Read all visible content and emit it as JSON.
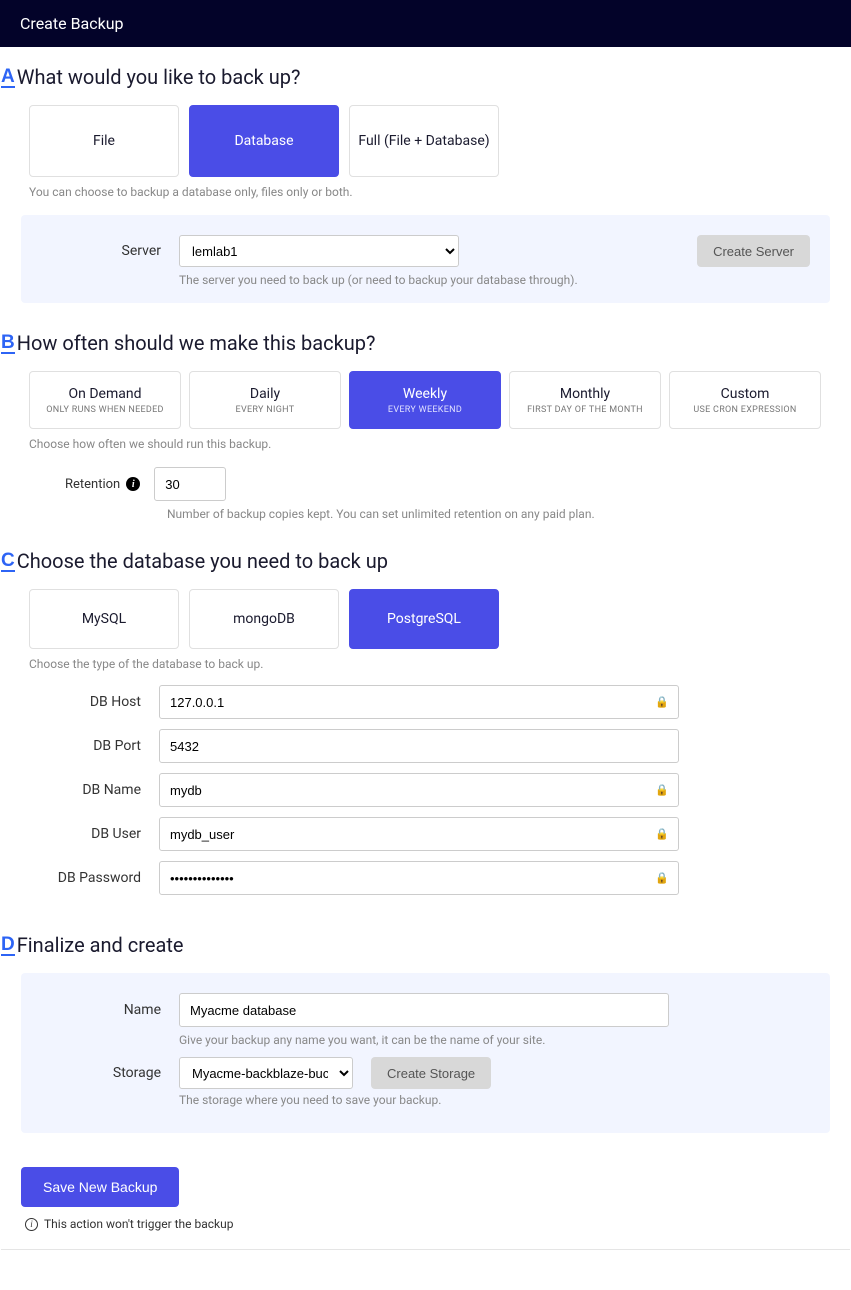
{
  "header": {
    "title": "Create Backup"
  },
  "sectionA": {
    "letter": "A",
    "title": "What would you like to back up?",
    "options": [
      {
        "label": "File"
      },
      {
        "label": "Database"
      },
      {
        "label": "Full (File + Database)"
      }
    ],
    "selected_index": 1,
    "hint": "You can choose to backup a database only, files only or both.",
    "server_label": "Server",
    "server_options": [
      "lemlab1"
    ],
    "server_selected": "lemlab1",
    "create_server_btn": "Create Server",
    "server_hint": "The server you need to back up (or need to backup your database through)."
  },
  "sectionB": {
    "letter": "B",
    "title": "How often should we make this backup?",
    "options": [
      {
        "label": "On Demand",
        "sub": "ONLY RUNS WHEN NEEDED"
      },
      {
        "label": "Daily",
        "sub": "EVERY NIGHT"
      },
      {
        "label": "Weekly",
        "sub": "EVERY WEEKEND"
      },
      {
        "label": "Monthly",
        "sub": "FIRST DAY OF THE MONTH"
      },
      {
        "label": "Custom",
        "sub": "USE CRON EXPRESSION"
      }
    ],
    "selected_index": 2,
    "hint": "Choose how often we should run this backup.",
    "retention_label": "Retention",
    "retention_value": "30",
    "retention_hint": "Number of backup copies kept. You can set unlimited retention on any paid plan."
  },
  "sectionC": {
    "letter": "C",
    "title": "Choose the database you need to back up",
    "options": [
      {
        "label": "MySQL"
      },
      {
        "label": "mongoDB"
      },
      {
        "label": "PostgreSQL"
      }
    ],
    "selected_index": 2,
    "hint": "Choose the type of the database to back up.",
    "fields": {
      "host_label": "DB Host",
      "host_value": "127.0.0.1",
      "port_label": "DB Port",
      "port_value": "5432",
      "name_label": "DB Name",
      "name_value": "mydb",
      "user_label": "DB User",
      "user_value": "mydb_user",
      "pass_label": "DB Password",
      "pass_value": "••••••••••••••"
    }
  },
  "sectionD": {
    "letter": "D",
    "title": "Finalize and create",
    "name_label": "Name",
    "name_value": "Myacme database",
    "name_hint": "Give your backup any name you want, it can be the name of your site.",
    "storage_label": "Storage",
    "storage_options": [
      "Myacme-backblaze-bucket"
    ],
    "storage_selected": "Myacme-backblaze-bucket",
    "create_storage_btn": "Create Storage",
    "storage_hint": "The storage where you need to save your backup."
  },
  "footer": {
    "save_btn": "Save New Backup",
    "note": "This action won't trigger the backup"
  }
}
